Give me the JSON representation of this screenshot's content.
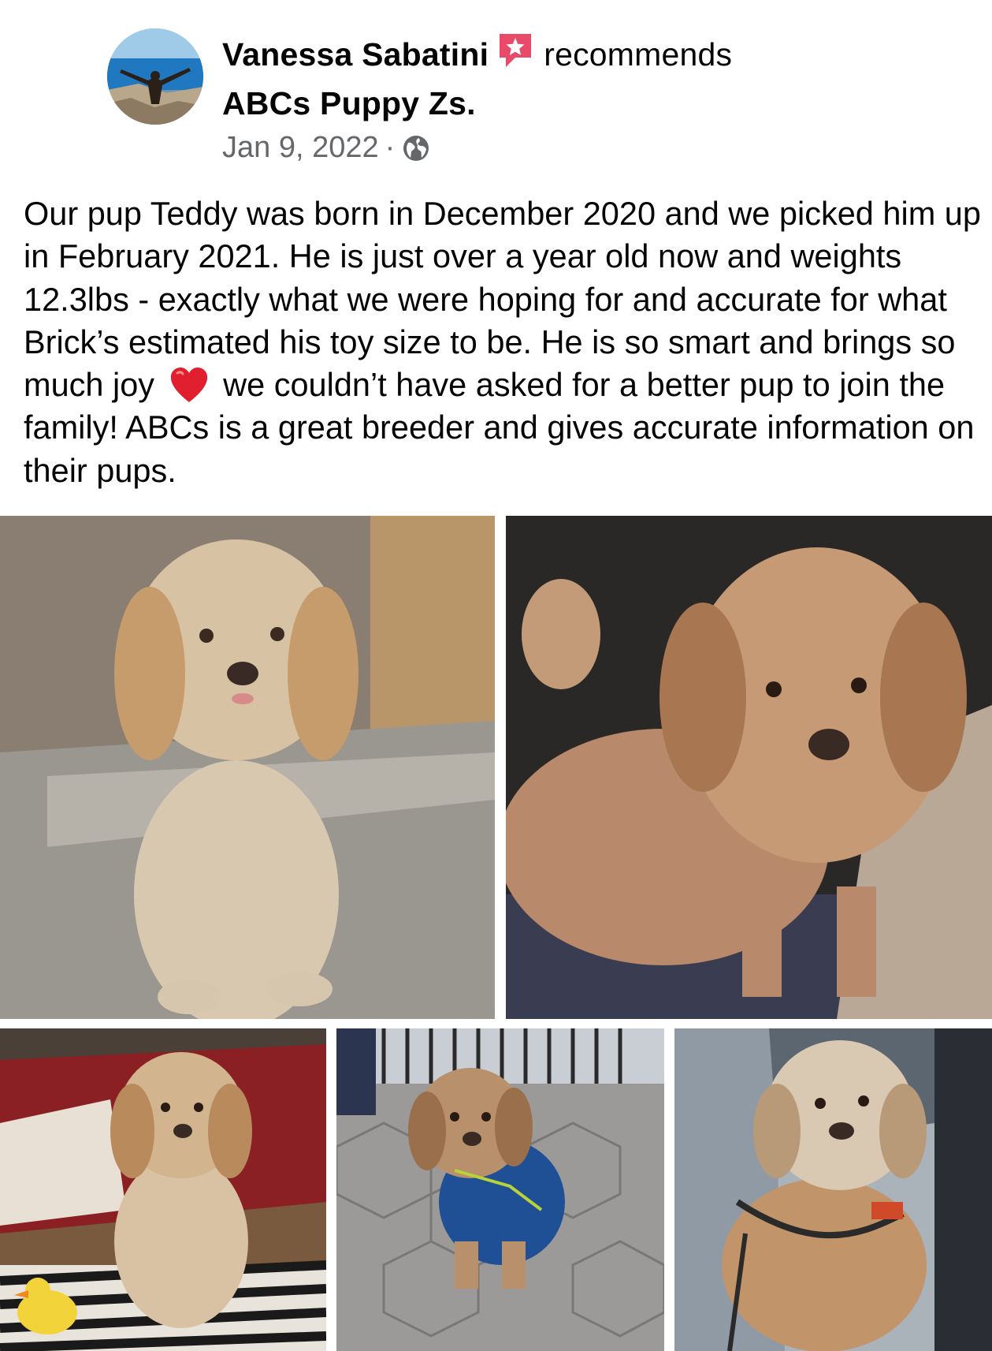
{
  "post": {
    "author": "Vanessa Sabatini",
    "action": "recommends",
    "page_name": "ABCs Puppy Zs.",
    "date": "Jan 9, 2022",
    "separator": "·",
    "privacy_icon": "globe-icon",
    "recommend_icon": "recommend-star-badge-icon",
    "text_before_emoji": "Our pup Teddy was born in December 2020 and we picked him up in February 2021. He is just over a year old now and weights 12.3lbs - exactly what we were hoping for and accurate for what Brick’s estimated his toy size to be. He is so smart and brings so much joy",
    "emoji": "heart-emoji",
    "text_after_emoji": "we couldn’t have asked for a better pup to join the family! ABCs is a great breeder and gives accurate information on their pups."
  },
  "photos": [
    {
      "name": "photo-dog-sitting-sunlight"
    },
    {
      "name": "photo-dog-closeup-bed"
    },
    {
      "name": "photo-dog-on-blanket-with-toy"
    },
    {
      "name": "photo-dog-in-blue-vest-outdoors"
    },
    {
      "name": "photo-dog-with-harness"
    }
  ],
  "colors": {
    "text": "#050505",
    "secondary_text": "#65676b",
    "recommend_badge": "#e84a6a",
    "heart": "#e0202e"
  }
}
